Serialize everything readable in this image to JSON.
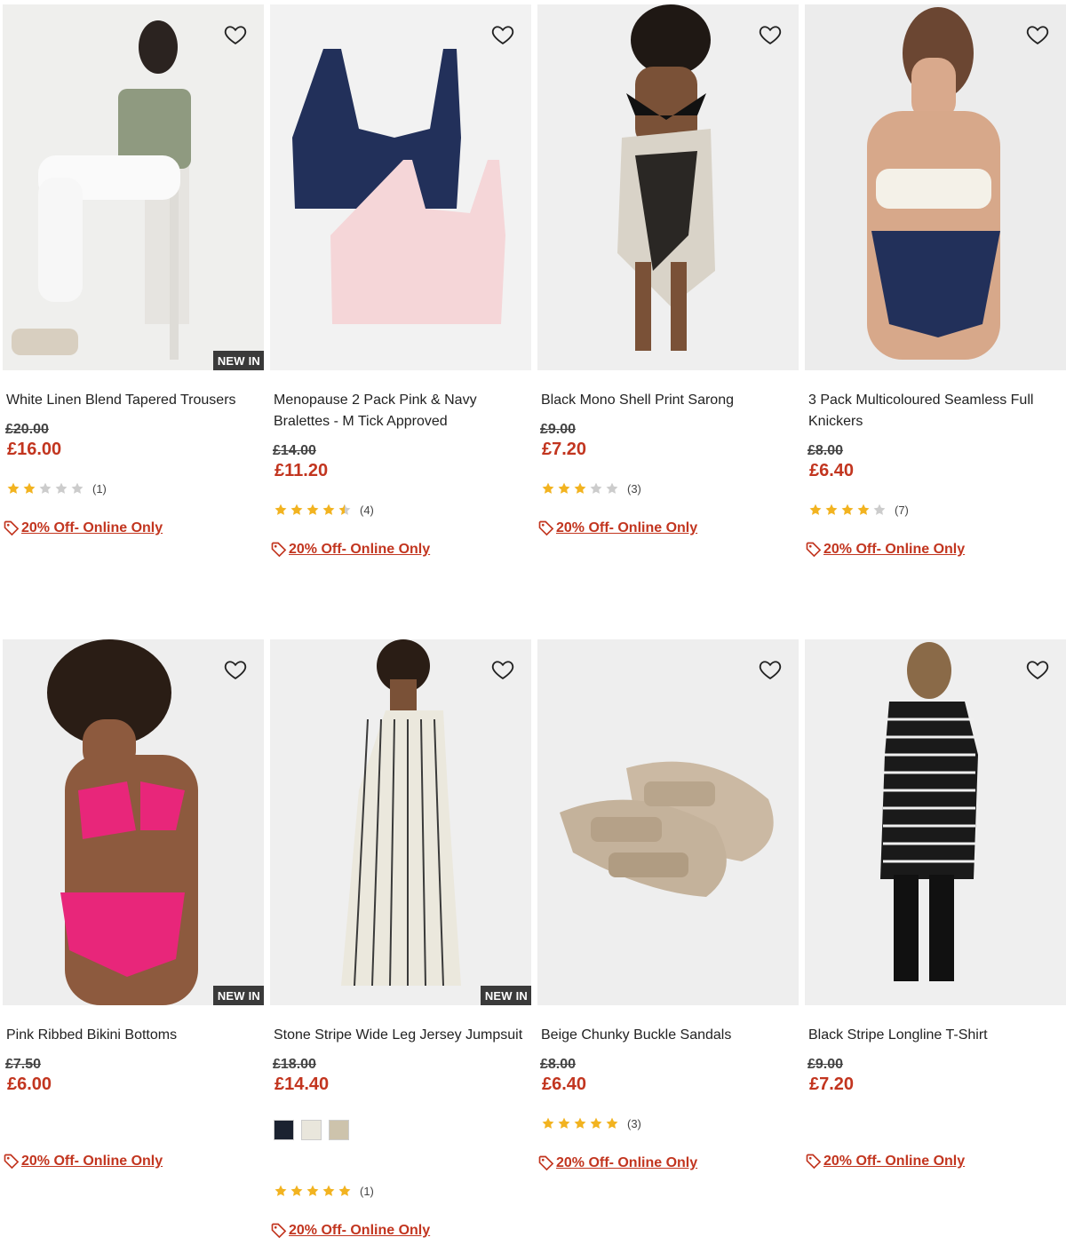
{
  "colors": {
    "sale_red": "#c2351f",
    "star_gold": "#f2b320",
    "star_grey": "#cccccc",
    "badge_bg": "#3a3a3a"
  },
  "icons": {
    "wishlist": "heart-outline-icon",
    "promo": "price-tag-icon",
    "rating": "star-icon"
  },
  "products": [
    {
      "title": "White Linen Blend Tapered Trousers",
      "was_price": "£20.00",
      "price": "£16.00",
      "badge": "NEW IN",
      "rating": 2,
      "review_count": "(1)",
      "promo": "20% Off- Online Only"
    },
    {
      "title": "Menopause 2 Pack Pink & Navy Bralettes - M Tick Approved",
      "was_price": "£14.00",
      "price": "£11.20",
      "badge": "",
      "rating": 4.5,
      "review_count": "(4)",
      "promo": "20% Off- Online Only"
    },
    {
      "title": "Black Mono Shell Print Sarong",
      "was_price": "£9.00",
      "price": "£7.20",
      "badge": "",
      "rating": 3,
      "review_count": "(3)",
      "promo": "20% Off- Online Only"
    },
    {
      "title": "3 Pack Multicoloured Seamless Full Knickers",
      "was_price": "£8.00",
      "price": "£6.40",
      "badge": "",
      "rating": 4,
      "review_count": "(7)",
      "promo": "20% Off- Online Only"
    },
    {
      "title": "Pink Ribbed Bikini Bottoms",
      "was_price": "£7.50",
      "price": "£6.00",
      "badge": "NEW IN",
      "rating": null,
      "review_count": "",
      "promo": "20% Off- Online Only"
    },
    {
      "title": "Stone Stripe Wide Leg Jersey Jumpsuit",
      "was_price": "£18.00",
      "price": "£14.40",
      "badge": "NEW IN",
      "rating": 5,
      "review_count": "(1)",
      "promo": "20% Off- Online Only",
      "swatches": [
        "#1b2230",
        "#e9e6dc",
        "#cdc3ac"
      ]
    },
    {
      "title": "Beige Chunky Buckle Sandals",
      "was_price": "£8.00",
      "price": "£6.40",
      "badge": "",
      "rating": 5,
      "review_count": "(3)",
      "promo": "20% Off- Online Only"
    },
    {
      "title": "Black Stripe Longline T-Shirt",
      "was_price": "£9.00",
      "price": "£7.20",
      "badge": "",
      "rating": null,
      "review_count": "",
      "promo": "20% Off- Online Only"
    }
  ]
}
